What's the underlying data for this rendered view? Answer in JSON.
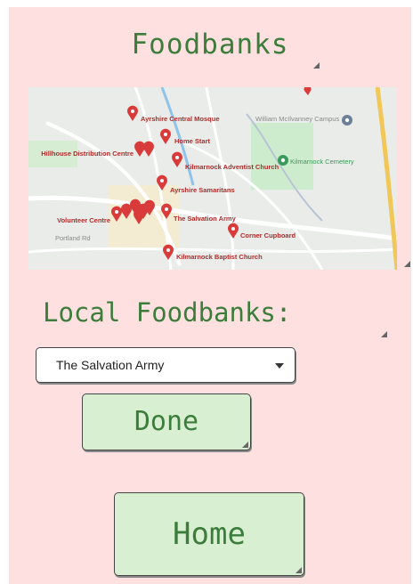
{
  "title": "Foodbanks",
  "map": {
    "pins": [
      {
        "label": "Ayrshire Central Mosque"
      },
      {
        "label": "Home Start"
      },
      {
        "label": "Hillhouse Distribution Centre"
      },
      {
        "label": "Kilmarnock Adventist Church"
      },
      {
        "label": "Ayrshire Samaritans"
      },
      {
        "label": "The Salvation Army"
      },
      {
        "label": "Volunteer Centre"
      },
      {
        "label": "Corner Cupboard"
      },
      {
        "label": "Kilmarnock Baptist Church"
      }
    ],
    "places": {
      "campus": "William McIlvanney Campus",
      "cemetery": "Kilmarnock Cemetery",
      "road": "Portland Rd"
    }
  },
  "subtitle": "Local Foodbanks:",
  "dropdown": {
    "selected": "The Salvation Army"
  },
  "buttons": {
    "done": "Done",
    "home": "Home"
  },
  "colors": {
    "background": "#ffe0e0",
    "text_green": "#3c7d3c",
    "button_fill": "#d8efd2",
    "pin_red": "#d93a3a"
  }
}
